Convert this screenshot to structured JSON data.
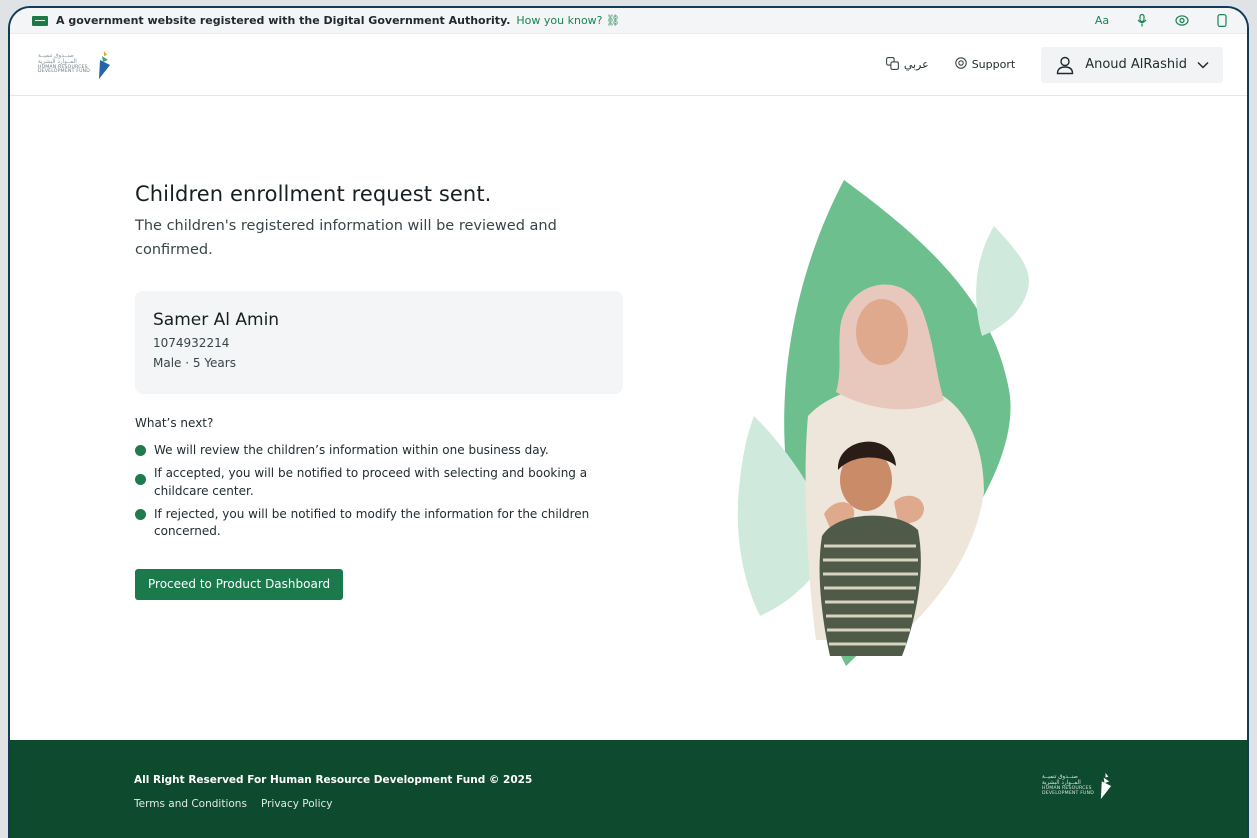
{
  "gov_banner": {
    "text": "A government website registered with the Digital Government Authority.",
    "link": "How you know?"
  },
  "header": {
    "logo": {
      "line1": "صنــدوق تنميــة",
      "line2": "المــوارد البشرية",
      "line3": "HUMAN RESOURCES",
      "line4": "DEVELOPMENT FUND"
    },
    "language": "عربي",
    "support": "Support",
    "user_name": "Anoud AlRashid"
  },
  "main": {
    "title": "Children enrollment request sent.",
    "subtitle": "The children's registered information will be reviewed and confirmed.",
    "child": {
      "name": "Samer Al Amin",
      "id": "1074932214",
      "meta": "Male · 5 Years"
    },
    "next_title": "What’s next?",
    "next_steps": [
      "We will review the children’s information within one business day.",
      "If accepted, you will be notified to proceed with selecting and booking a childcare center.",
      "If rejected, you will be notified to modify the information for the children concerned."
    ],
    "cta_label": "Proceed to Product Dashboard"
  },
  "footer": {
    "copyright": "All Right Reserved For Human Resource Development Fund © 2025",
    "links": [
      "Terms and Conditions",
      "Privacy Policy"
    ]
  },
  "colors": {
    "brand_green": "#1b7a4c",
    "footer_green": "#0d4a2e",
    "leaf_green": "#6dbf8e",
    "leaf_light": "#cfe9dc"
  },
  "icons": {
    "flag": "saudi-flag-icon",
    "link": "link-icon",
    "font_size": "font-size-icon",
    "voice": "microphone-icon",
    "vision": "eye-icon",
    "device": "device-icon",
    "language": "translate-icon",
    "support": "support-icon",
    "user": "user-icon",
    "dropdown": "chevron-down-icon"
  }
}
